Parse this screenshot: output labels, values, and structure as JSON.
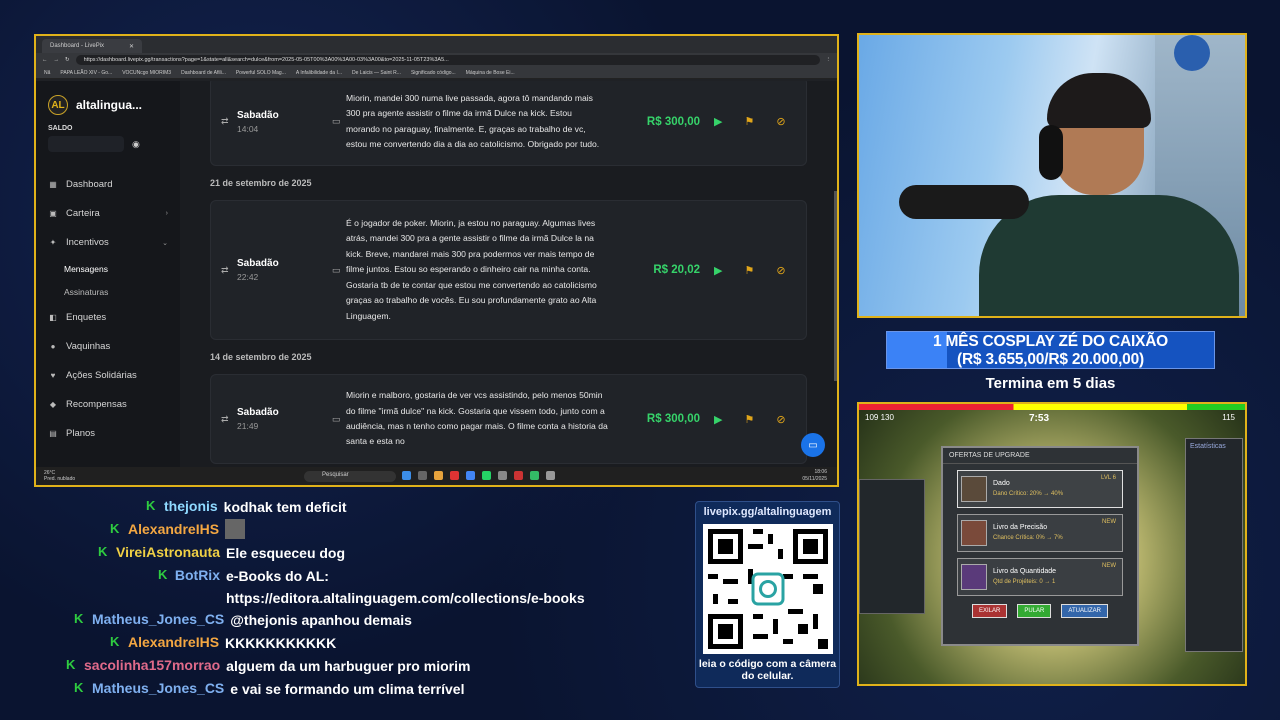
{
  "browser": {
    "tab_title": "Dashboard - LivePix",
    "url": "https://dashboard.livepix.gg/transactions?page=1&state=all&search=dulce&from=2025-05-05T00%3A00%3A00-03%3A00&to=2025-11-05T23%3A5...",
    "bookmarks": [
      "Nã",
      "PAPA LEÃO XIV - Go...",
      "VOCUNcgo MIORIM3",
      "Dashboard de Afili...",
      "Powerful SOLO Mag...",
      "A Infalibilidade da I...",
      "De Laicis — Saint R...",
      "Significado código...",
      "Máquina de Bose Ei..."
    ]
  },
  "sidebar": {
    "brand": "altalingua...",
    "brand_logo": "AL",
    "saldo_label": "SALDO",
    "items": [
      {
        "label": "Dashboard",
        "icon": "dashboard-icon"
      },
      {
        "label": "Carteira",
        "icon": "wallet-icon"
      },
      {
        "label": "Incentivos",
        "icon": "sparkle-icon"
      },
      {
        "label": "Mensagens"
      },
      {
        "label": "Assinaturas"
      },
      {
        "label": "Enquetes",
        "icon": "poll-icon"
      },
      {
        "label": "Vaquinhas",
        "icon": "piggy-icon"
      },
      {
        "label": "Ações Solidárias",
        "icon": "heart-icon"
      },
      {
        "label": "Recompensas",
        "icon": "gift-icon"
      },
      {
        "label": "Planos",
        "icon": "plans-icon"
      }
    ]
  },
  "transactions": {
    "date2": "21 de setembro de 2025",
    "date3": "14 de setembro de 2025",
    "items": [
      {
        "day": "Sabadão",
        "time": "14:04",
        "message": "Miorin, mandei 300 numa live passada, agora tô mandando mais 300 pra agente assistir o filme da irmã Dulce na kick. Estou morando no paraguay, finalmente. E, graças ao trabalho de vc, estou me convertendo dia a dia ao catolicismo. Obrigado por tudo.",
        "amount": "R$ 300,00"
      },
      {
        "day": "Sabadão",
        "time": "22:42",
        "message": "É o jogador de poker. Miorin, ja estou no paraguay. Algumas lives atrás, mandei 300 pra a gente assistir o filme da irmã Dulce la na kick. Breve, mandarei mais 300 pra podermos ver mais tempo de filme juntos. Estou so esperando o dinheiro cair na minha conta. Gostaria tb de te contar que estou me convertendo ao catolicismo graças ao trabalho de vocês. Eu sou profundamente grato ao Alta Linguagem.",
        "amount": "R$ 20,02"
      },
      {
        "day": "Sabadão",
        "time": "21:49",
        "message": "Miorin e malboro, gostaria de ver vcs assistindo, pelo menos 50min do filme \"irmã dulce\" na kick. Gostaria que vissem todo, junto com a audiência, mas n tenho como pagar mais. O filme conta a historia da santa e esta no",
        "amount": "R$ 300,00"
      }
    ]
  },
  "taskbar": {
    "search": "Pesquisar",
    "weather_temp": "26°C",
    "weather_desc": "Pred. nublado",
    "time": "18:06",
    "date": "05/11/2025"
  },
  "goal": {
    "title": "1 MÊS COSPLAY ZÉ DO CAIXÃO",
    "amounts": "(R$ 3.655,00/R$ 20.000,00)",
    "progress": 0.1828,
    "ends": "Termina em 5 dias"
  },
  "game": {
    "hud_left": "109  130",
    "time": "7:53",
    "hud_right": "115",
    "stats_title": "Estatísticas",
    "panel_title": "OFERTAS DE UPGRADE",
    "upgrades": [
      {
        "tag": "Common",
        "name": "Dado",
        "stat": "Dano Crítico: 20% → 40%",
        "level": "LVL 6"
      },
      {
        "tag": "New",
        "name": "Livro da Precisão",
        "stat": "Chance Crítica: 0% → 7%",
        "level": "NEW"
      },
      {
        "tag": "New",
        "name": "Livro da Quantidade",
        "stat": "Qtd de Projéteis: 0 → 1",
        "level": "NEW"
      }
    ],
    "buttons": [
      "EXILAR",
      "PULAR",
      "ATUALIZAR"
    ]
  },
  "chat": [
    {
      "user": "thejonis",
      "msg": "kodhak tem deficit"
    },
    {
      "user": "AlexandreIHS",
      "msg": ""
    },
    {
      "user": "VireiAstronauta",
      "msg": "Ele esqueceu dog"
    },
    {
      "user": "BotRix",
      "msg": "e-Books do AL: https://editora.altalinguagem.com/collections/e-books"
    },
    {
      "user": "Matheus_Jones_CS",
      "msg": "@thejonis apanhou demais"
    },
    {
      "user": "AlexandreIHS",
      "msg": "KKKKKKKKKKK"
    },
    {
      "user": "sacolinha157morrao",
      "msg": "alguem da um harbuguer pro miorim"
    },
    {
      "user": "Matheus_Jones_CS",
      "msg": "e vai se formando um clima terrível"
    }
  ],
  "qr": {
    "top": "livepix.gg/altalinguagem",
    "bottom": "leia o código com a câmera do celular."
  },
  "colors": {
    "accent": "#e0b21a",
    "amount": "#36d36a",
    "goal": "#1553c0"
  }
}
